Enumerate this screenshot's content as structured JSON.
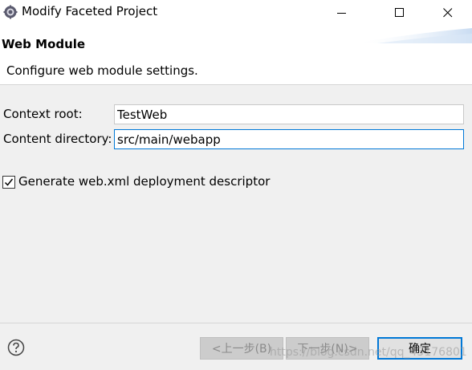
{
  "window": {
    "title": "Modify Faceted Project",
    "min_icon": "minimize-icon",
    "max_icon": "maximize-icon",
    "close_icon": "close-icon"
  },
  "header": {
    "title": "Web Module",
    "description": "Configure web module settings."
  },
  "form": {
    "context_root_label": "Context root:",
    "context_root_value": "TestWeb",
    "content_directory_label": "Content directory:",
    "content_directory_value": "src/main/webapp",
    "generate_checkbox_label": "Generate web.xml deployment descriptor",
    "generate_checked": true
  },
  "footer": {
    "help_icon": "help-icon",
    "back_label": "<上一步(B)",
    "next_label": "下一步(N)>",
    "ok_label": "确定"
  },
  "watermark": "https://blog.csdn.net/qq_43176801",
  "colors": {
    "accent": "#0078d7",
    "window_bg": "#f0f0f0",
    "header_bg": "#ffffff"
  }
}
